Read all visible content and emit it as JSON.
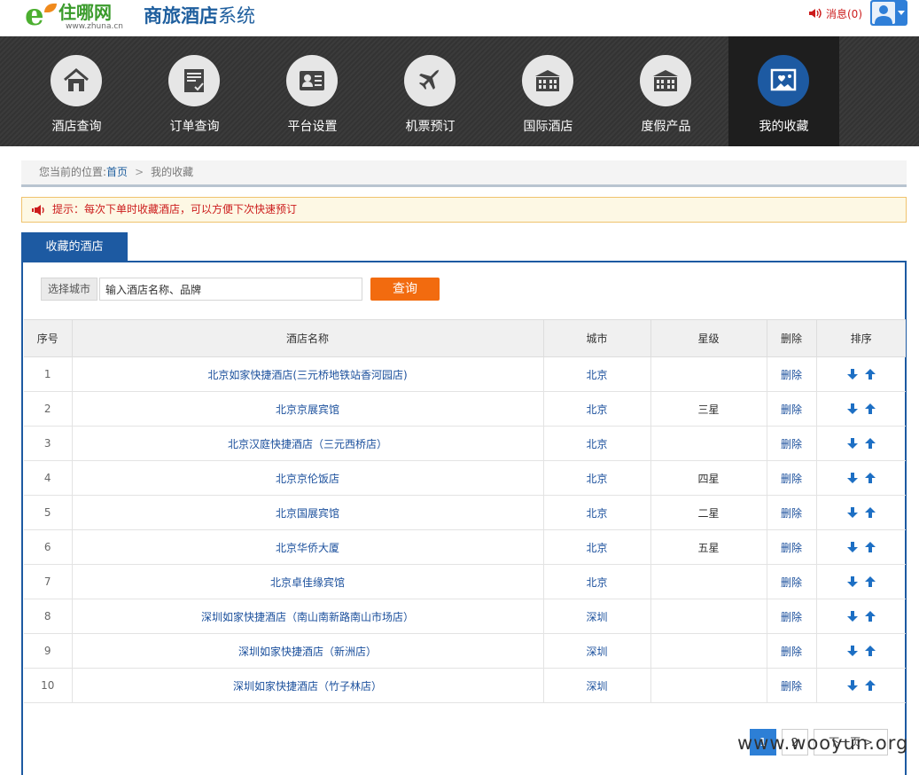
{
  "brand": {
    "logo_name": "住哪网",
    "logo_url": "www.zhuna.cn",
    "system_title_a": "商旅酒店",
    "system_title_b": "系统"
  },
  "header": {
    "message_label": "消息(0)"
  },
  "nav": {
    "items": [
      {
        "label": "酒店查询",
        "icon": "house-icon"
      },
      {
        "label": "订单查询",
        "icon": "order-document-icon"
      },
      {
        "label": "平台设置",
        "icon": "id-card-icon"
      },
      {
        "label": "机票预订",
        "icon": "airplane-icon"
      },
      {
        "label": "国际酒店",
        "icon": "building-icon"
      },
      {
        "label": "度假产品",
        "icon": "building-icon"
      },
      {
        "label": "我的收藏",
        "icon": "favorite-photo-icon"
      }
    ],
    "active_index": 6
  },
  "breadcrumb": {
    "prefix": "您当前的位置:",
    "home": "首页",
    "separator": ">",
    "current": "我的收藏"
  },
  "tip": {
    "text": "提示：每次下单时收藏酒店，可以方便下次快速预订"
  },
  "tab": {
    "label": "收藏的酒店"
  },
  "search": {
    "city_button": "选择城市",
    "input_value": "输入酒店名称、品牌",
    "query_button": "查询"
  },
  "table": {
    "headers": [
      "序号",
      "酒店名称",
      "城市",
      "星级",
      "删除",
      "排序"
    ],
    "rows": [
      {
        "idx": "1",
        "name": "北京如家快捷酒店(三元桥地铁站香河园店)",
        "city": "北京",
        "star": "",
        "del": "删除"
      },
      {
        "idx": "2",
        "name": "北京京展宾馆",
        "city": "北京",
        "star": "三星",
        "del": "删除"
      },
      {
        "idx": "3",
        "name": "北京汉庭快捷酒店（三元西桥店）",
        "city": "北京",
        "star": "",
        "del": "删除"
      },
      {
        "idx": "4",
        "name": "北京京伦饭店",
        "city": "北京",
        "star": "四星",
        "del": "删除"
      },
      {
        "idx": "5",
        "name": "北京国展宾馆",
        "city": "北京",
        "star": "二星",
        "del": "删除"
      },
      {
        "idx": "6",
        "name": "北京华侨大厦",
        "city": "北京",
        "star": "五星",
        "del": "删除"
      },
      {
        "idx": "7",
        "name": "北京卓佳缘宾馆",
        "city": "北京",
        "star": "",
        "del": "删除"
      },
      {
        "idx": "8",
        "name": "深圳如家快捷酒店（南山南新路南山市场店）",
        "city": "深圳",
        "star": "",
        "del": "删除"
      },
      {
        "idx": "9",
        "name": "深圳如家快捷酒店（新洲店）",
        "city": "深圳",
        "star": "",
        "del": "删除"
      },
      {
        "idx": "10",
        "name": "深圳如家快捷酒店（竹子林店）",
        "city": "深圳",
        "star": "",
        "del": "删除"
      }
    ]
  },
  "pager": {
    "pages": [
      "1",
      "2"
    ],
    "current": "1",
    "next_label": "下一页 >"
  },
  "watermark": "www.wooyun.org",
  "colors": {
    "primary_blue": "#1d5aa2",
    "link_blue": "#1a4f9c",
    "orange": "#f26b0f",
    "alert_red": "#cc1c1c",
    "nav_dark": "#3a3a3a",
    "tip_bg": "#fdf8e4"
  }
}
